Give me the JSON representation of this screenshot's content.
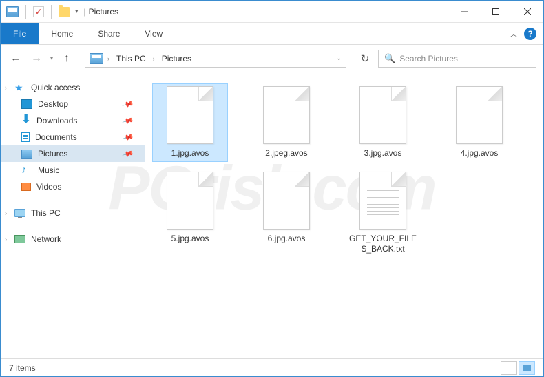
{
  "window": {
    "title": "Pictures"
  },
  "ribbon": {
    "file": "File",
    "tabs": [
      "Home",
      "Share",
      "View"
    ]
  },
  "breadcrumb": {
    "segments": [
      "This PC",
      "Pictures"
    ]
  },
  "search": {
    "placeholder": "Search Pictures"
  },
  "sidebar": {
    "quick_access": {
      "label": "Quick access",
      "items": [
        {
          "label": "Desktop",
          "pinned": true,
          "icon": "desktop"
        },
        {
          "label": "Downloads",
          "pinned": true,
          "icon": "downloads"
        },
        {
          "label": "Documents",
          "pinned": true,
          "icon": "documents"
        },
        {
          "label": "Pictures",
          "pinned": true,
          "icon": "pictures",
          "selected": true
        },
        {
          "label": "Music",
          "pinned": false,
          "icon": "music"
        },
        {
          "label": "Videos",
          "pinned": false,
          "icon": "videos"
        }
      ]
    },
    "this_pc": {
      "label": "This PC"
    },
    "network": {
      "label": "Network"
    }
  },
  "files": [
    {
      "name": "1.jpg.avos",
      "type": "blank",
      "selected": true
    },
    {
      "name": "2.jpeg.avos",
      "type": "blank"
    },
    {
      "name": "3.jpg.avos",
      "type": "blank"
    },
    {
      "name": "4.jpg.avos",
      "type": "blank"
    },
    {
      "name": "5.jpg.avos",
      "type": "blank"
    },
    {
      "name": "6.jpg.avos",
      "type": "blank"
    },
    {
      "name": "GET_YOUR_FILES_BACK.txt",
      "type": "txt"
    }
  ],
  "status": {
    "count_label": "7 items"
  }
}
